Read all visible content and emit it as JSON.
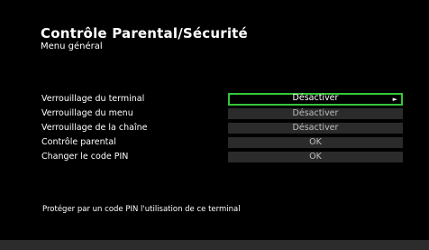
{
  "header": {
    "title": "Contrôle Parental/Sécurité",
    "subtitle": "Menu général"
  },
  "menu": {
    "items": [
      {
        "label": "Verrouillage du terminal",
        "value": "Désactiver",
        "arrow": "►",
        "selected": true
      },
      {
        "label": "Verrouillage du menu",
        "value": "Désactiver"
      },
      {
        "label": "Verrouillage de la chaîne",
        "value": "Désactiver"
      },
      {
        "label": "Contrôle parental",
        "value": "OK"
      },
      {
        "label": "Changer le code PIN",
        "value": "OK"
      }
    ]
  },
  "footer": {
    "help": "Protéger par un code PIN l'utilisation de ce terminal"
  },
  "colors": {
    "background": "#000000",
    "selection_border": "#35c639",
    "value_box": "#2b2b2b"
  }
}
